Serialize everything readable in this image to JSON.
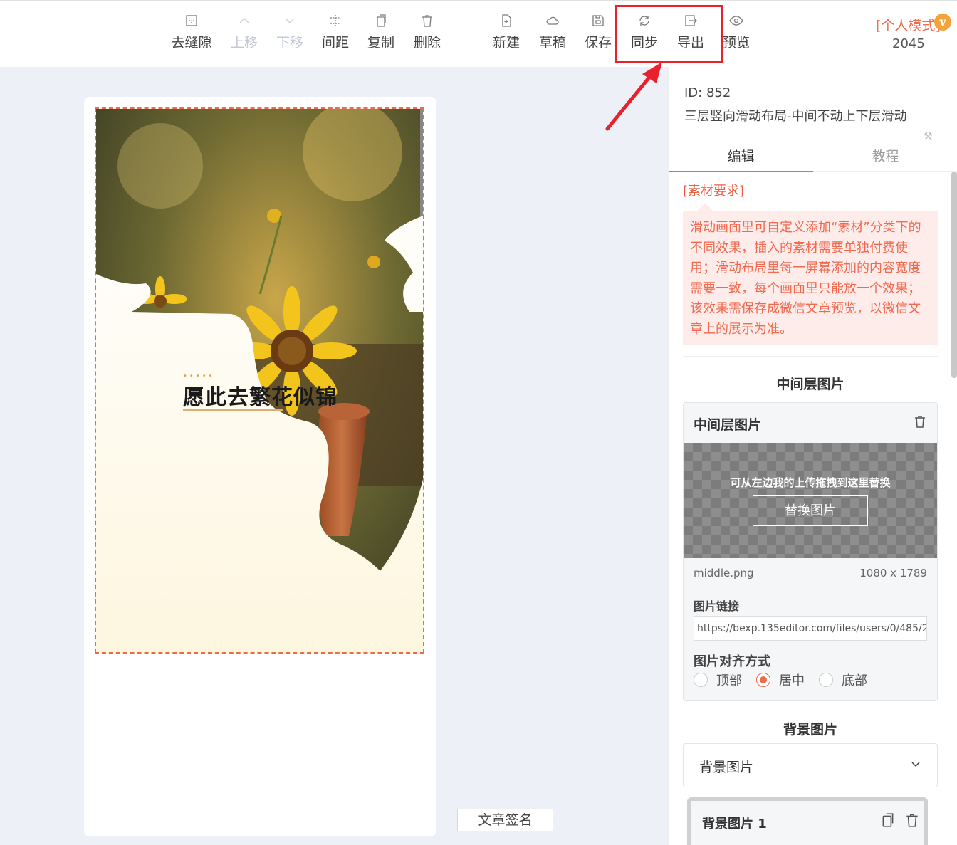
{
  "toolbar": {
    "items": [
      {
        "id": "seamless",
        "label": "去缝隙",
        "icon": "grid-dotted-icon",
        "disabled": false
      },
      {
        "id": "move_up",
        "label": "上移",
        "icon": "chevron-up-icon",
        "disabled": true
      },
      {
        "id": "move_down",
        "label": "下移",
        "icon": "chevron-down-icon",
        "disabled": true
      },
      {
        "id": "spacing",
        "label": "间距",
        "icon": "spacing-icon",
        "disabled": false
      },
      {
        "id": "copy",
        "label": "复制",
        "icon": "copy-icon",
        "disabled": false
      },
      {
        "id": "delete",
        "label": "删除",
        "icon": "trash-icon",
        "disabled": false
      },
      {
        "id": "new",
        "label": "新建",
        "icon": "new-file-icon",
        "disabled": false
      },
      {
        "id": "draft",
        "label": "草稿",
        "icon": "cloud-icon",
        "disabled": false
      },
      {
        "id": "save",
        "label": "保存",
        "icon": "save-icon",
        "disabled": false
      },
      {
        "id": "sync",
        "label": "同步",
        "icon": "sync-icon",
        "disabled": false
      },
      {
        "id": "export",
        "label": "导出",
        "icon": "export-icon",
        "disabled": false
      },
      {
        "id": "preview",
        "label": "预览",
        "icon": "eye-icon",
        "disabled": false
      }
    ],
    "mode_label": "[个人模式]",
    "vip_badge": "v",
    "user_number": "2045"
  },
  "canvas": {
    "title": "愿此去繁花似锦",
    "dots": "•••••",
    "signature_button": "文章签名"
  },
  "panel": {
    "template_id": "ID: 852",
    "template_name": "三层竖向滑动布局-中间不动上下层滑动",
    "tabs": [
      {
        "label": "编辑",
        "active": true
      },
      {
        "label": "教程",
        "active": false
      }
    ],
    "requirement_title": "[素材要求]",
    "requirement_text": "滑动画面里可自定义添加“素材”分类下的不同效果，插入的素材需要单独付费使用；滑动布局里每一屏幕添加的内容宽度需要一致，每个画面里只能放一个效果；该效果需保存成微信文章预览，以微信文章上的展示为准。",
    "middle_section_title": "中间层图片",
    "middle_card": {
      "header": "中间层图片",
      "hint": "可从左边我的上传拖拽到这里替换",
      "replace_button": "替换图片",
      "file_name": "middle.png",
      "file_size": "1080 x 1789",
      "link_label": "图片链接",
      "link_value": "https://bexp.135editor.com/files/users/0/485/2",
      "align_label": "图片对齐方式",
      "align_options": [
        {
          "label": "顶部",
          "checked": false
        },
        {
          "label": "居中",
          "checked": true
        },
        {
          "label": "底部",
          "checked": false
        }
      ]
    },
    "bg_section_title": "背景图片",
    "bg_select_label": "背景图片",
    "bg_item_label": "背景图片 1"
  },
  "colors": {
    "accent": "#ee6a4c",
    "highlight_red": "#e8212c",
    "canvas_bg": "#eef0f7"
  }
}
